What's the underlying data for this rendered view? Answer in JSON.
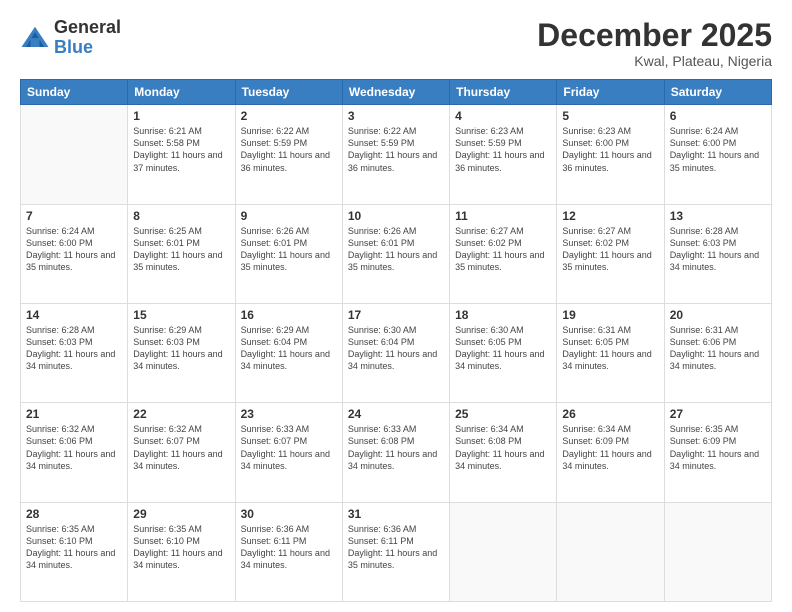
{
  "logo": {
    "general": "General",
    "blue": "Blue"
  },
  "title": "December 2025",
  "location": "Kwal, Plateau, Nigeria",
  "days": [
    "Sunday",
    "Monday",
    "Tuesday",
    "Wednesday",
    "Thursday",
    "Friday",
    "Saturday"
  ],
  "weeks": [
    [
      {
        "num": "",
        "sunrise": "",
        "sunset": "",
        "daylight": ""
      },
      {
        "num": "1",
        "sunrise": "Sunrise: 6:21 AM",
        "sunset": "Sunset: 5:58 PM",
        "daylight": "Daylight: 11 hours and 37 minutes."
      },
      {
        "num": "2",
        "sunrise": "Sunrise: 6:22 AM",
        "sunset": "Sunset: 5:59 PM",
        "daylight": "Daylight: 11 hours and 36 minutes."
      },
      {
        "num": "3",
        "sunrise": "Sunrise: 6:22 AM",
        "sunset": "Sunset: 5:59 PM",
        "daylight": "Daylight: 11 hours and 36 minutes."
      },
      {
        "num": "4",
        "sunrise": "Sunrise: 6:23 AM",
        "sunset": "Sunset: 5:59 PM",
        "daylight": "Daylight: 11 hours and 36 minutes."
      },
      {
        "num": "5",
        "sunrise": "Sunrise: 6:23 AM",
        "sunset": "Sunset: 6:00 PM",
        "daylight": "Daylight: 11 hours and 36 minutes."
      },
      {
        "num": "6",
        "sunrise": "Sunrise: 6:24 AM",
        "sunset": "Sunset: 6:00 PM",
        "daylight": "Daylight: 11 hours and 35 minutes."
      }
    ],
    [
      {
        "num": "7",
        "sunrise": "Sunrise: 6:24 AM",
        "sunset": "Sunset: 6:00 PM",
        "daylight": "Daylight: 11 hours and 35 minutes."
      },
      {
        "num": "8",
        "sunrise": "Sunrise: 6:25 AM",
        "sunset": "Sunset: 6:01 PM",
        "daylight": "Daylight: 11 hours and 35 minutes."
      },
      {
        "num": "9",
        "sunrise": "Sunrise: 6:26 AM",
        "sunset": "Sunset: 6:01 PM",
        "daylight": "Daylight: 11 hours and 35 minutes."
      },
      {
        "num": "10",
        "sunrise": "Sunrise: 6:26 AM",
        "sunset": "Sunset: 6:01 PM",
        "daylight": "Daylight: 11 hours and 35 minutes."
      },
      {
        "num": "11",
        "sunrise": "Sunrise: 6:27 AM",
        "sunset": "Sunset: 6:02 PM",
        "daylight": "Daylight: 11 hours and 35 minutes."
      },
      {
        "num": "12",
        "sunrise": "Sunrise: 6:27 AM",
        "sunset": "Sunset: 6:02 PM",
        "daylight": "Daylight: 11 hours and 35 minutes."
      },
      {
        "num": "13",
        "sunrise": "Sunrise: 6:28 AM",
        "sunset": "Sunset: 6:03 PM",
        "daylight": "Daylight: 11 hours and 34 minutes."
      }
    ],
    [
      {
        "num": "14",
        "sunrise": "Sunrise: 6:28 AM",
        "sunset": "Sunset: 6:03 PM",
        "daylight": "Daylight: 11 hours and 34 minutes."
      },
      {
        "num": "15",
        "sunrise": "Sunrise: 6:29 AM",
        "sunset": "Sunset: 6:03 PM",
        "daylight": "Daylight: 11 hours and 34 minutes."
      },
      {
        "num": "16",
        "sunrise": "Sunrise: 6:29 AM",
        "sunset": "Sunset: 6:04 PM",
        "daylight": "Daylight: 11 hours and 34 minutes."
      },
      {
        "num": "17",
        "sunrise": "Sunrise: 6:30 AM",
        "sunset": "Sunset: 6:04 PM",
        "daylight": "Daylight: 11 hours and 34 minutes."
      },
      {
        "num": "18",
        "sunrise": "Sunrise: 6:30 AM",
        "sunset": "Sunset: 6:05 PM",
        "daylight": "Daylight: 11 hours and 34 minutes."
      },
      {
        "num": "19",
        "sunrise": "Sunrise: 6:31 AM",
        "sunset": "Sunset: 6:05 PM",
        "daylight": "Daylight: 11 hours and 34 minutes."
      },
      {
        "num": "20",
        "sunrise": "Sunrise: 6:31 AM",
        "sunset": "Sunset: 6:06 PM",
        "daylight": "Daylight: 11 hours and 34 minutes."
      }
    ],
    [
      {
        "num": "21",
        "sunrise": "Sunrise: 6:32 AM",
        "sunset": "Sunset: 6:06 PM",
        "daylight": "Daylight: 11 hours and 34 minutes."
      },
      {
        "num": "22",
        "sunrise": "Sunrise: 6:32 AM",
        "sunset": "Sunset: 6:07 PM",
        "daylight": "Daylight: 11 hours and 34 minutes."
      },
      {
        "num": "23",
        "sunrise": "Sunrise: 6:33 AM",
        "sunset": "Sunset: 6:07 PM",
        "daylight": "Daylight: 11 hours and 34 minutes."
      },
      {
        "num": "24",
        "sunrise": "Sunrise: 6:33 AM",
        "sunset": "Sunset: 6:08 PM",
        "daylight": "Daylight: 11 hours and 34 minutes."
      },
      {
        "num": "25",
        "sunrise": "Sunrise: 6:34 AM",
        "sunset": "Sunset: 6:08 PM",
        "daylight": "Daylight: 11 hours and 34 minutes."
      },
      {
        "num": "26",
        "sunrise": "Sunrise: 6:34 AM",
        "sunset": "Sunset: 6:09 PM",
        "daylight": "Daylight: 11 hours and 34 minutes."
      },
      {
        "num": "27",
        "sunrise": "Sunrise: 6:35 AM",
        "sunset": "Sunset: 6:09 PM",
        "daylight": "Daylight: 11 hours and 34 minutes."
      }
    ],
    [
      {
        "num": "28",
        "sunrise": "Sunrise: 6:35 AM",
        "sunset": "Sunset: 6:10 PM",
        "daylight": "Daylight: 11 hours and 34 minutes."
      },
      {
        "num": "29",
        "sunrise": "Sunrise: 6:35 AM",
        "sunset": "Sunset: 6:10 PM",
        "daylight": "Daylight: 11 hours and 34 minutes."
      },
      {
        "num": "30",
        "sunrise": "Sunrise: 6:36 AM",
        "sunset": "Sunset: 6:11 PM",
        "daylight": "Daylight: 11 hours and 34 minutes."
      },
      {
        "num": "31",
        "sunrise": "Sunrise: 6:36 AM",
        "sunset": "Sunset: 6:11 PM",
        "daylight": "Daylight: 11 hours and 35 minutes."
      },
      {
        "num": "",
        "sunrise": "",
        "sunset": "",
        "daylight": ""
      },
      {
        "num": "",
        "sunrise": "",
        "sunset": "",
        "daylight": ""
      },
      {
        "num": "",
        "sunrise": "",
        "sunset": "",
        "daylight": ""
      }
    ]
  ]
}
